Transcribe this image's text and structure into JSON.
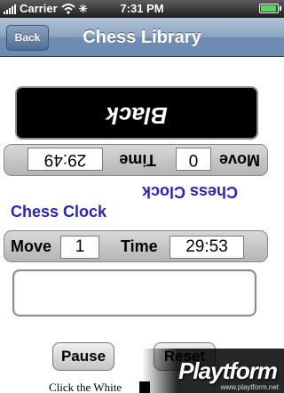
{
  "status_bar": {
    "carrier": "Carrier",
    "time": "7:31 PM"
  },
  "nav": {
    "back_label": "Back",
    "title": "Chess Library"
  },
  "black": {
    "label": "Black",
    "move_label": "Move",
    "move_value": "0",
    "time_label": "Time",
    "time_value": "29:49"
  },
  "flipped_title": "Chess Clock",
  "title": "Chess Clock",
  "white": {
    "move_label": "Move",
    "move_value": "1",
    "time_label": "Time",
    "time_value": "29:53"
  },
  "buttons": {
    "pause": "Pause",
    "reset": "Reset"
  },
  "caption": "Click the White",
  "watermark": {
    "logo": "Playtform",
    "url": "www.playtform.net"
  }
}
